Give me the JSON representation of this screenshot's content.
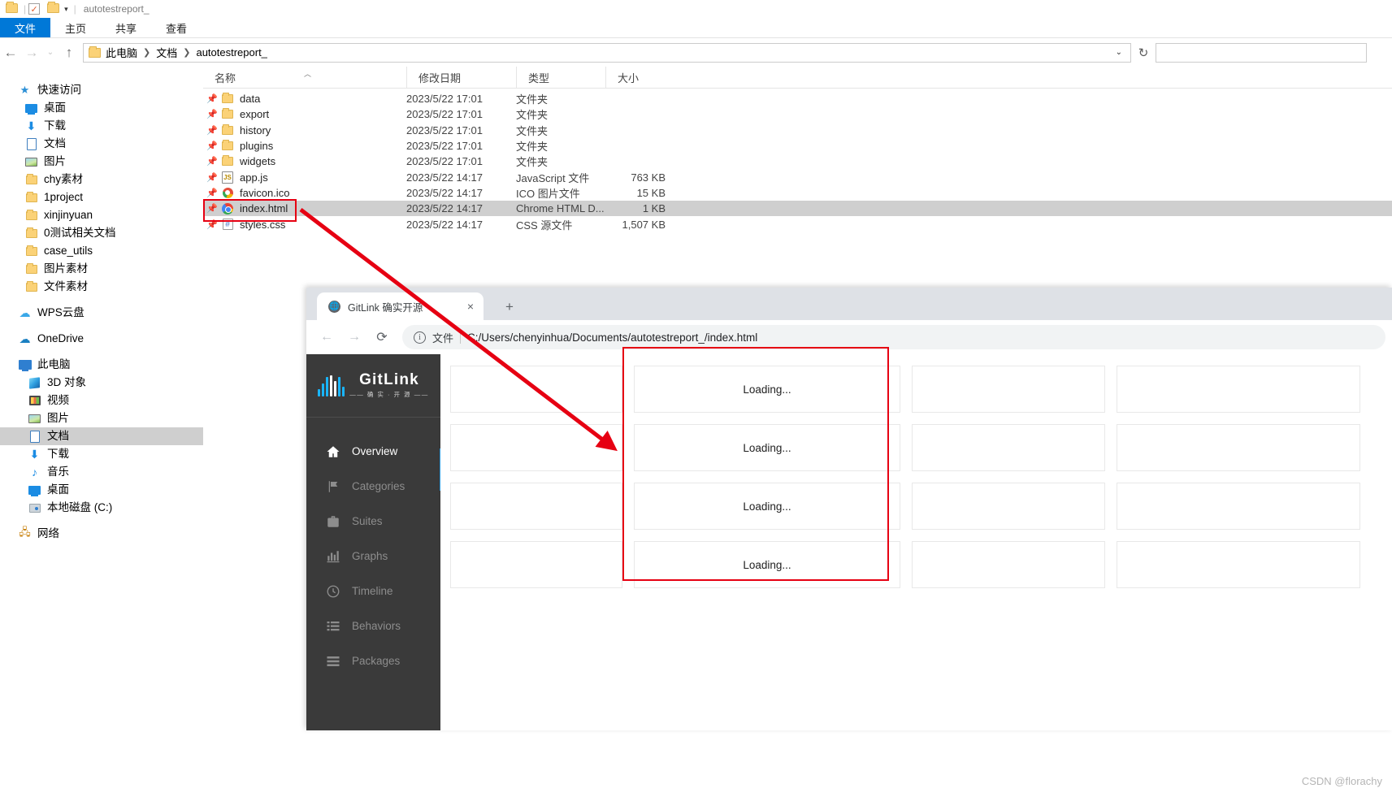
{
  "explorer": {
    "title": "autotestreport_",
    "quick_access_icons": [
      "folder-icon",
      "properties-icon",
      "new-folder-icon",
      "customize-caret-icon"
    ],
    "ribbon_tabs": [
      {
        "label": "文件",
        "active": true
      },
      {
        "label": "主页",
        "active": false
      },
      {
        "label": "共享",
        "active": false
      },
      {
        "label": "查看",
        "active": false
      }
    ],
    "nav": {
      "back": "←",
      "forward": "→",
      "recent": "⌄",
      "up": "↑",
      "refresh": "↻",
      "crumb_dropdown": "⌄"
    },
    "breadcrumb": [
      "此电脑",
      "文档",
      "autotestreport_"
    ],
    "search_placeholder": "",
    "tree": [
      {
        "label": "快速访问",
        "icon": "star-icon",
        "indent": 0,
        "selected": false
      },
      {
        "label": "桌面",
        "icon": "desktop-icon",
        "indent": 1,
        "selected": false
      },
      {
        "label": "下载",
        "icon": "download-icon",
        "indent": 1,
        "selected": false
      },
      {
        "label": "文档",
        "icon": "document-icon",
        "indent": 1,
        "selected": false
      },
      {
        "label": "图片",
        "icon": "picture-icon",
        "indent": 1,
        "selected": false
      },
      {
        "label": "chy素材",
        "icon": "folder-icon",
        "indent": 1,
        "selected": false
      },
      {
        "label": "1project",
        "icon": "folder-icon",
        "indent": 1,
        "selected": false
      },
      {
        "label": "xinjinyuan",
        "icon": "folder-icon",
        "indent": 1,
        "selected": false
      },
      {
        "label": "0测试相关文档",
        "icon": "folder-icon",
        "indent": 1,
        "selected": false
      },
      {
        "label": "case_utils",
        "icon": "folder-icon",
        "indent": 1,
        "selected": false
      },
      {
        "label": "图片素材",
        "icon": "folder-icon",
        "indent": 1,
        "selected": false
      },
      {
        "label": "文件素材",
        "icon": "folder-icon",
        "indent": 1,
        "selected": false
      },
      {
        "label": "WPS云盘",
        "icon": "cloud-wps-icon",
        "indent": 0,
        "selected": false,
        "gap_before": true
      },
      {
        "label": "OneDrive",
        "icon": "cloud-onedrive-icon",
        "indent": 0,
        "selected": false,
        "gap_before": true
      },
      {
        "label": "此电脑",
        "icon": "this-pc-icon",
        "indent": 0,
        "selected": false,
        "gap_before": true
      },
      {
        "label": "3D 对象",
        "icon": "3d-objects-icon",
        "indent": 1,
        "selected": false
      },
      {
        "label": "视频",
        "icon": "video-icon",
        "indent": 1,
        "selected": false
      },
      {
        "label": "图片",
        "icon": "picture-icon",
        "indent": 1,
        "selected": false
      },
      {
        "label": "文档",
        "icon": "document-icon",
        "indent": 1,
        "selected": true
      },
      {
        "label": "下载",
        "icon": "download-icon",
        "indent": 1,
        "selected": false
      },
      {
        "label": "音乐",
        "icon": "music-icon",
        "indent": 1,
        "selected": false
      },
      {
        "label": "桌面",
        "icon": "desktop-icon",
        "indent": 1,
        "selected": false
      },
      {
        "label": "本地磁盘 (C:)",
        "icon": "drive-icon",
        "indent": 1,
        "selected": false
      },
      {
        "label": "网络",
        "icon": "network-icon",
        "indent": 0,
        "selected": false,
        "gap_before": true
      }
    ],
    "columns": {
      "name": "名称",
      "date": "修改日期",
      "type": "类型",
      "size": "大小"
    },
    "files": [
      {
        "name": "data",
        "date": "2023/5/22 17:01",
        "type": "文件夹",
        "size": "",
        "icon": "folder-icon",
        "selected": false
      },
      {
        "name": "export",
        "date": "2023/5/22 17:01",
        "type": "文件夹",
        "size": "",
        "icon": "folder-icon",
        "selected": false
      },
      {
        "name": "history",
        "date": "2023/5/22 17:01",
        "type": "文件夹",
        "size": "",
        "icon": "folder-icon",
        "selected": false
      },
      {
        "name": "plugins",
        "date": "2023/5/22 17:01",
        "type": "文件夹",
        "size": "",
        "icon": "folder-icon",
        "selected": false
      },
      {
        "name": "widgets",
        "date": "2023/5/22 17:01",
        "type": "文件夹",
        "size": "",
        "icon": "folder-icon",
        "selected": false
      },
      {
        "name": "app.js",
        "date": "2023/5/22 14:17",
        "type": "JavaScript 文件",
        "size": "763 KB",
        "icon": "javascript-file-icon",
        "selected": false
      },
      {
        "name": "favicon.ico",
        "date": "2023/5/22 14:17",
        "type": "ICO 图片文件",
        "size": "15 KB",
        "icon": "ico-file-icon",
        "selected": false
      },
      {
        "name": "index.html",
        "date": "2023/5/22 14:17",
        "type": "Chrome HTML D...",
        "size": "1 KB",
        "icon": "chrome-file-icon",
        "selected": true
      },
      {
        "name": "styles.css",
        "date": "2023/5/22 14:17",
        "type": "CSS 源文件",
        "size": "1,507 KB",
        "icon": "css-file-icon",
        "selected": false
      }
    ]
  },
  "chrome": {
    "tab": {
      "title": "GitLink 确实开源",
      "favicon": "globe-icon",
      "close_label": "×"
    },
    "new_tab_label": "+",
    "toolbar": {
      "back": "←",
      "forward": "→",
      "reload": "⟳"
    },
    "omnibox": {
      "info_icon": "info-icon",
      "scheme_label": "文件",
      "url": "C:/Users/chenyinhua/Documents/autotestreport_/index.html"
    }
  },
  "gitlink": {
    "logo": {
      "name": "GitLink",
      "slogan": "—— 确 实 · 开 源 ——"
    },
    "nav": [
      {
        "label": "Overview",
        "icon": "home-icon",
        "active": true
      },
      {
        "label": "Categories",
        "icon": "flag-icon",
        "active": false
      },
      {
        "label": "Suites",
        "icon": "briefcase-icon",
        "active": false
      },
      {
        "label": "Graphs",
        "icon": "bar-chart-icon",
        "active": false
      },
      {
        "label": "Timeline",
        "icon": "clock-icon",
        "active": false
      },
      {
        "label": "Behaviors",
        "icon": "list-icon",
        "active": false
      },
      {
        "label": "Packages",
        "icon": "stack-icon",
        "active": false
      }
    ],
    "cards": [
      {
        "col1": "",
        "col2": "Loading...",
        "col3": "",
        "col4": ""
      },
      {
        "col1": "",
        "col2": "Loading...",
        "col3": "",
        "col4": ""
      },
      {
        "col1": "",
        "col2": "Loading...",
        "col3": "",
        "col4": ""
      },
      {
        "col1": "",
        "col2": "Loading...",
        "col3": "",
        "col4": ""
      }
    ]
  },
  "annotations": {
    "highlight_color": "#e60012",
    "watermark": "CSDN @florachy"
  }
}
